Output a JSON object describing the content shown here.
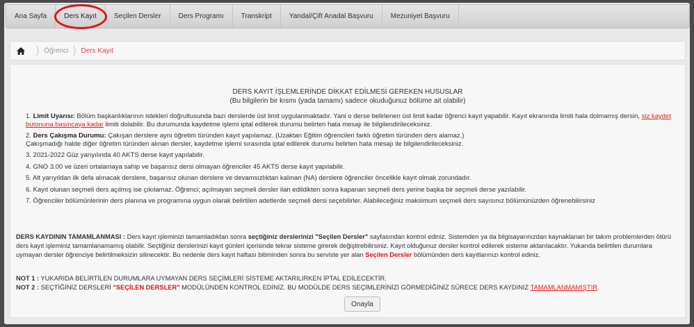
{
  "nav": {
    "items": [
      "Ana Sayfa",
      "Ders Kayıt",
      "Seçilen Dersler",
      "Ders Programı",
      "Transkript",
      "Yandal/Çift Anadal Başvuru",
      "Mezuniyet Başvuru"
    ]
  },
  "highlight_color": "#d9131a",
  "breadcrumb": {
    "home_icon": "home-icon",
    "items": [
      "Öğrenci",
      "Ders Kayıt"
    ]
  },
  "notice": {
    "title": "DERS KAYIT İŞLEMLERİNDE DİKKAT EDİLMESİ GEREKEN HUSUSLAR",
    "subtitle": "(Bu bilgilerin bir kısmı (yada tamamı) sadece okuduğunuz bölüme ait olabilir)",
    "r1_num": "1.",
    "r1_label": "Limit Uyarısı:",
    "r1_text": " Bölüm başkanlıklarının istekleri doğrultusunda bazı derslerde üst limit uygulanmaktadır. Yani o derse belirlenen üst limit kadar öğrenci kayıt yapabilir. Kayıt ekranında limiti hala dolmamış dersin, ",
    "r1_link": "siz kaydet butonuna basıncaya kadar",
    "r1_tail": " limiti dolabilir. Bu durumunda kaydetme işlemi iptal edilerek durumu belirten hata mesajı ile bilgilendirileceksiniz.",
    "r2_num": "2.",
    "r2_label": "Ders Çakışma Durumu:",
    "r2_text": " Çakışan derslere aynı öğretim türünden kayıt yapılamaz. (Uzaktan Eğitim öğrencileri farklı öğretim türünden ders alamaz.)",
    "r2_line2": "Çakışmadığı halde diğer öğretim türünden alınan dersler, kaydetme işlemi sırasında iptal edilerek durumu belirten hata mesajı ile bilgilendirileceksiniz.",
    "r3": "3. 2021-2022 Güz yarıyılında 40 AKTS derse kayıt yapılabilir.",
    "r4": "4. GNO 3.00 ve üzeri ortalamaya sahip ve başarısız dersi olmayan öğrenciler 45 AKTS derse kayıt yapılabilir.",
    "r5": "5. Alt yarıyıldan ilk defa alınacak derslere, başarısız olunan derslere ve devamsızlıktan kalınan (NA) derslere öğrenciler öncelikle kayıt olmak zorundadır.",
    "r6": "6. Kayıt olunan seçmeli ders açılmış ise çıkılamaz. Öğrenci; açılmayan seçmeli dersler ilan edildikten sonra kapanan seçmeli ders yerine başka bir seçmeli derse yazılabilir.",
    "r7": "7. Öğrenciler bölümünlerinin ders planına ve programına uygun olarak belirtilen adetlerde seçmeli dersi seçebilirler. Alabileceğiniz maksimum seçmeli ders sayısınız bölümünüzden öğrenebilirsiniz"
  },
  "completion": {
    "label": "DERS KAYDININ TAMAMLANMASI :",
    "t1": " Ders kayıt işleminizi tamamladıktan sonra ",
    "b1": "seçtiğiniz derslerinizi \"Seçilen Dersler\"",
    "t2": " sayfasından kontrol ediniz. Sistemden ya da bilgisayarınızdan kaynaklanan bir takım problemlerden ötürü ders kayıt işleminiz tamamlanamamış olabilir. Seçtiğiniz derslerinizi kayıt günleri içerisinde tekrar sisteme girerek değiştirebilirsiniz. Kayıt olduğunuz dersler kontrol edilerek sisteme aktarılacaktır. Yukarıda belirtilen durumlara uymayan dersler öğrenciye belirtilmeksizin silinecektir. Bu nedenle ders kayıt haftası bitiminden sonra bu serviste yer alan ",
    "red": "Seçilen Dersler",
    "t3": " bölümünden ders kayıtlarınızı kontrol ediniz."
  },
  "notes": {
    "n1_label": "NOT 1 :",
    "n1_text": " YUKARIDA BELİRTİLEN DURUMLARA UYMAYAN DERS SEÇİMLERİ SİSTEME AKTARILIRKEN İPTAL EDİLECEKTİR.",
    "n2_label": "NOT 2 :",
    "n2_text": " SEÇTİĞİNİZ DERSLERİ ",
    "n2_red": "\"SEÇİLEN DERSLER\"",
    "n2_text2": " MODÜLÜNDEN KONTROL EDİNİZ. BU MODÜLDE DERS SEÇİMLERİNİZİ GÖRMEDİĞİNİZ SÜRECE DERS KAYDINIZ ",
    "n2_link": "TAMAMLANMAMIŞTIR",
    "n2_end": "."
  },
  "confirm_button": "Onayla"
}
